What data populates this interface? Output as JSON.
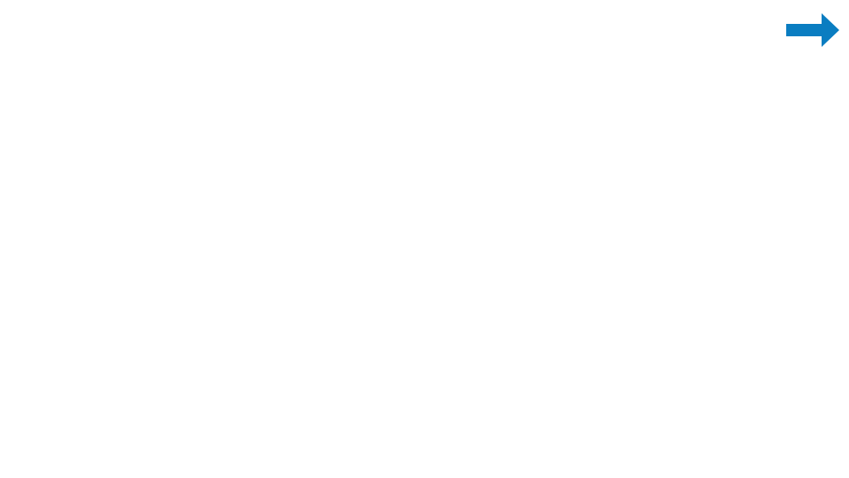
{
  "navigation": {
    "next_icon": "arrow-right-icon",
    "accent_color": "#0a7dc1"
  }
}
